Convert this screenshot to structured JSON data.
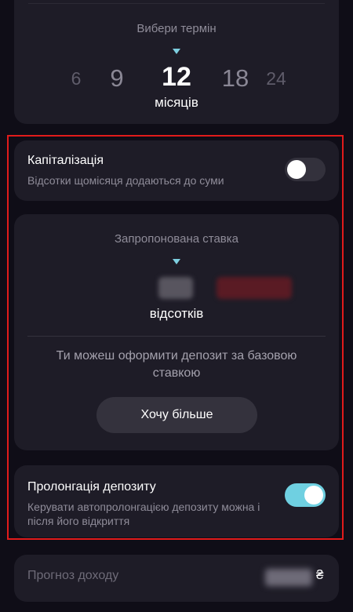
{
  "term": {
    "title": "Вибери термін",
    "options": [
      "6",
      "9",
      "12",
      "18",
      "24"
    ],
    "selected": "12",
    "unit": "місяців"
  },
  "capitalization": {
    "title": "Капіталізація",
    "subtitle": "Відсотки щомісяця додаються до суми",
    "enabled": false
  },
  "rate": {
    "title": "Запропонована ставка",
    "unit": "відсотків",
    "message": "Ти можеш оформити депозит за базовою ставкою",
    "button_label": "Хочу більше"
  },
  "prolongation": {
    "title": "Пролонгація депозиту",
    "subtitle": "Керувати автопролонгацією депозиту можна і після його відкриття",
    "enabled": true
  },
  "income": {
    "label": "Прогноз доходу",
    "currency": "₴"
  },
  "colors": {
    "background": "#0f0d17",
    "card": "#1e1c27",
    "accent": "#6fd0e1",
    "highlight": "#e11b1b"
  }
}
